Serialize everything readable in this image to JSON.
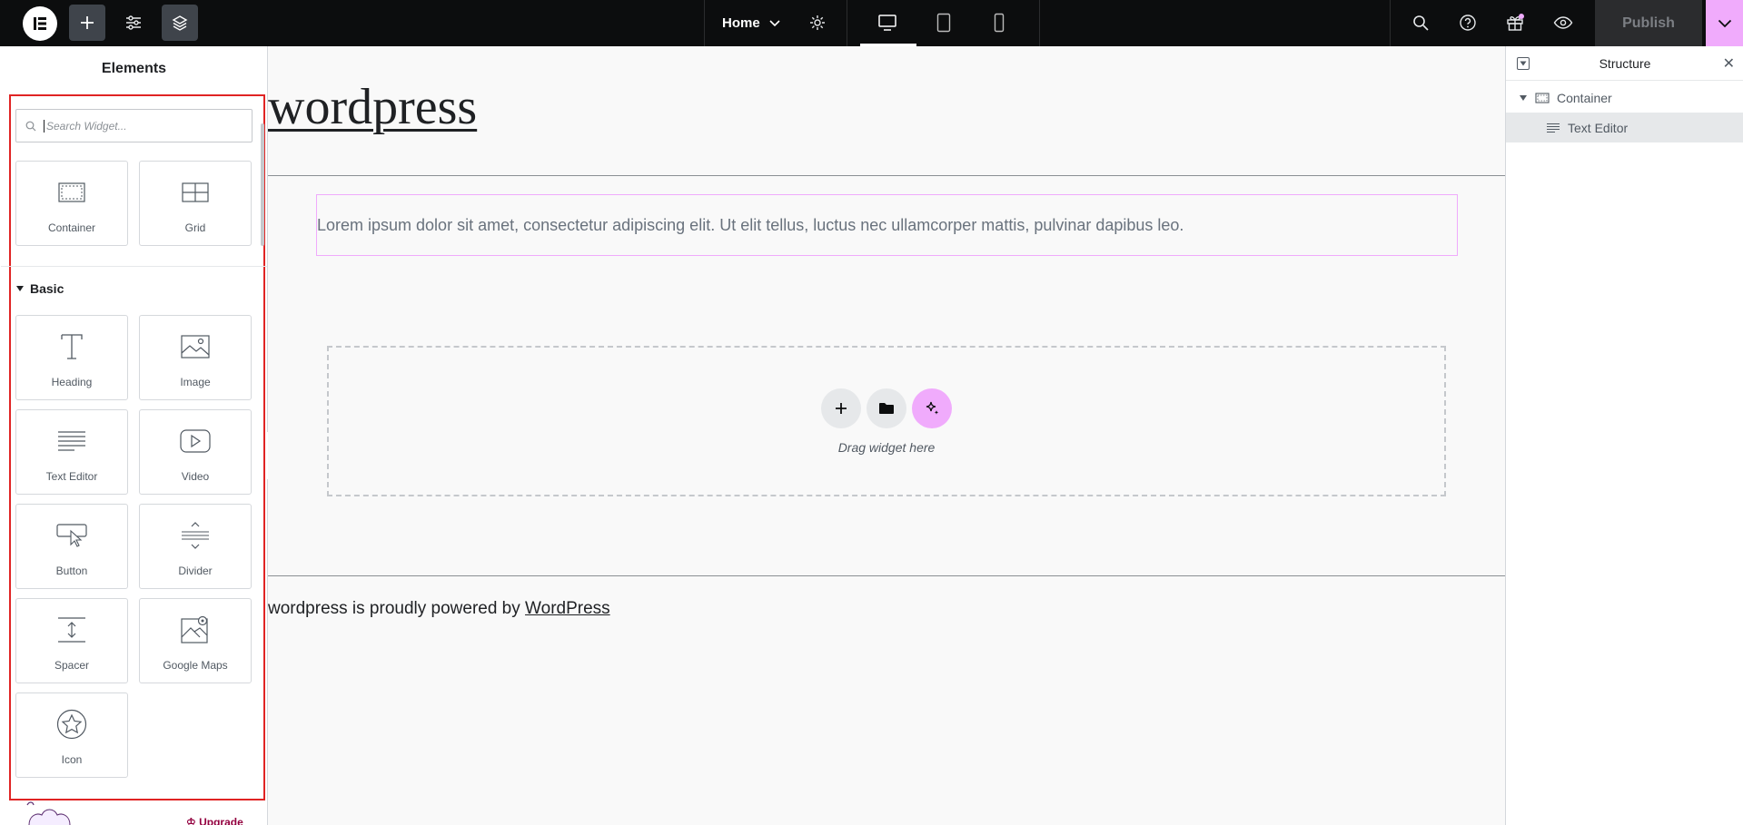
{
  "topbar": {
    "page_name": "Home",
    "publish_label": "Publish"
  },
  "left_panel": {
    "title": "Elements",
    "search_placeholder": "Search Widget...",
    "layout_widgets": [
      {
        "label": "Container",
        "icon": "container-icon"
      },
      {
        "label": "Grid",
        "icon": "grid-icon"
      }
    ],
    "section_title": "Basic",
    "basic_widgets": [
      {
        "label": "Heading",
        "icon": "heading-icon"
      },
      {
        "label": "Image",
        "icon": "image-icon"
      },
      {
        "label": "Text Editor",
        "icon": "text-editor-icon"
      },
      {
        "label": "Video",
        "icon": "video-icon"
      },
      {
        "label": "Button",
        "icon": "button-icon"
      },
      {
        "label": "Divider",
        "icon": "divider-icon"
      },
      {
        "label": "Spacer",
        "icon": "spacer-icon"
      },
      {
        "label": "Google Maps",
        "icon": "google-maps-icon"
      },
      {
        "label": "Icon",
        "icon": "star-icon"
      }
    ],
    "upgrade_label": "Upgrade"
  },
  "canvas": {
    "site_title": "wordpress",
    "text_widget": "Lorem ipsum dolor sit amet, consectetur adipiscing elit. Ut elit tellus, luctus nec ullamcorper mattis, pulvinar dapibus leo.",
    "dropzone_hint": "Drag widget here",
    "footer_prefix": "wordpress is proudly powered by ",
    "footer_link": "WordPress"
  },
  "structure_panel": {
    "title": "Structure",
    "items": [
      {
        "label": "Container",
        "selected": false
      },
      {
        "label": "Text Editor",
        "selected": true
      }
    ]
  },
  "colors": {
    "accent": "#f0abfc",
    "highlight_border": "#e02424",
    "topbar_bg": "#0c0d0e"
  }
}
